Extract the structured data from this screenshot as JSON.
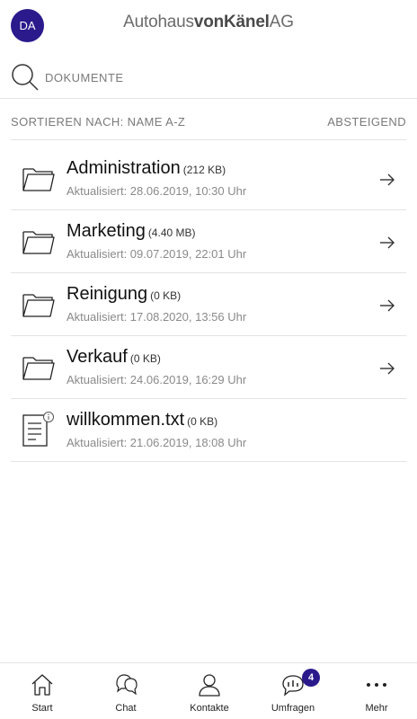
{
  "header": {
    "avatar_initials": "DA",
    "brand_part1": "Autohaus",
    "brand_part2": "vonKänel",
    "brand_part3": "AG"
  },
  "search": {
    "placeholder": "DOKUMENTE",
    "icon": "search-icon"
  },
  "sort": {
    "sort_by_label": "SORTIEREN NACH: NAME A-Z",
    "order_label": "ABSTEIGEND"
  },
  "items": [
    {
      "type": "folder",
      "name": "Administration",
      "size": "(212 KB)",
      "updated": "Aktualisiert: 28.06.2019, 10:30 Uhr"
    },
    {
      "type": "folder",
      "name": "Marketing",
      "size": "(4.40 MB)",
      "updated": "Aktualisiert: 09.07.2019, 22:01 Uhr"
    },
    {
      "type": "folder",
      "name": "Reinigung",
      "size": "(0 KB)",
      "updated": "Aktualisiert: 17.08.2020, 13:56 Uhr"
    },
    {
      "type": "folder",
      "name": "Verkauf",
      "size": "(0 KB)",
      "updated": "Aktualisiert: 24.06.2019, 16:29 Uhr"
    },
    {
      "type": "file",
      "name": "willkommen.txt",
      "size": "(0 KB)",
      "updated": "Aktualisiert: 21.06.2019, 18:08 Uhr"
    }
  ],
  "tabbar": {
    "tabs": [
      {
        "label": "Start",
        "icon": "home-icon"
      },
      {
        "label": "Chat",
        "icon": "chat-icon"
      },
      {
        "label": "Kontakte",
        "icon": "contact-icon"
      },
      {
        "label": "Umfragen",
        "icon": "survey-icon",
        "badge": "4"
      },
      {
        "label": "Mehr",
        "icon": "more-icon"
      }
    ]
  },
  "colors": {
    "accent": "#2a1a8c",
    "divider": "#e3e3e3",
    "muted_text": "#8a8a8a"
  }
}
